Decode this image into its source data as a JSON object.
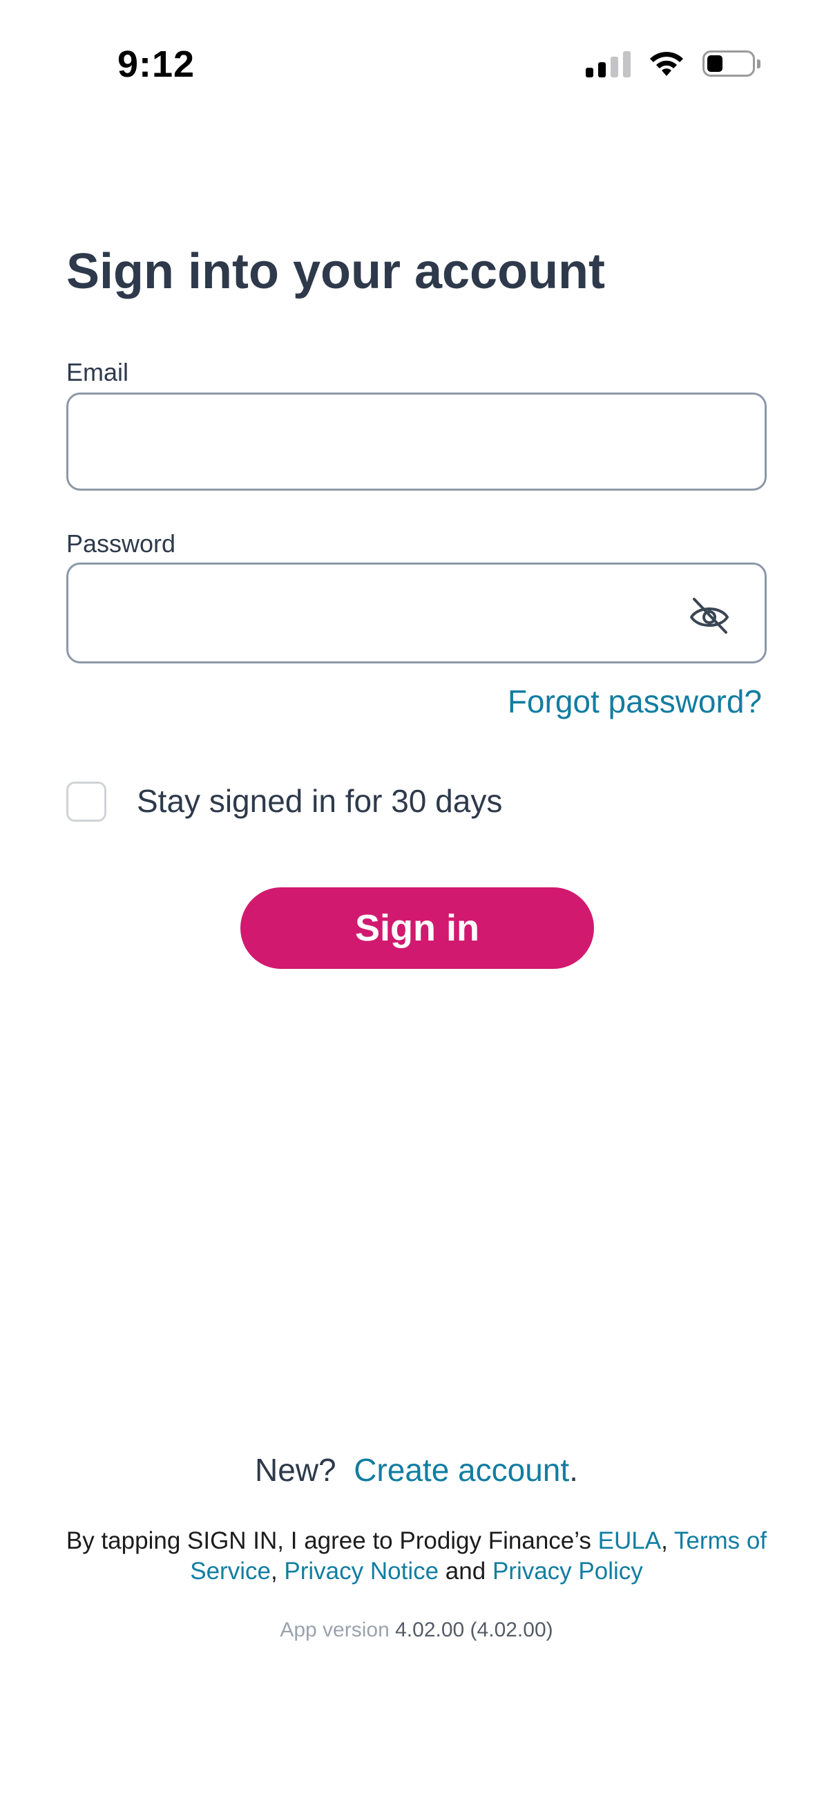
{
  "status_bar": {
    "time": "9:12"
  },
  "page": {
    "title": "Sign into your account"
  },
  "form": {
    "email_label": "Email",
    "email_value": "",
    "password_label": "Password",
    "password_value": "",
    "forgot_password": "Forgot password?",
    "stay_signed_in_label": "Stay signed in for 30 days",
    "stay_signed_in_checked": false,
    "sign_in_button": "Sign in"
  },
  "footer": {
    "new_text": "New?",
    "create_account": "Create account",
    "period": ".",
    "legal_prefix": "By tapping SIGN IN, I agree to Prodigy Finance’s ",
    "eula": "EULA",
    "comma1": ", ",
    "terms": "Terms of Service",
    "comma2": ", ",
    "privacy_notice": "Privacy Notice",
    "and": " and ",
    "privacy_policy": "Privacy Policy",
    "app_version_label": "App version",
    "app_version_value": "4.02.00 (4.02.00)"
  },
  "colors": {
    "accent": "#d11a6f",
    "link": "#127da1",
    "text": "#2e3a4b"
  }
}
